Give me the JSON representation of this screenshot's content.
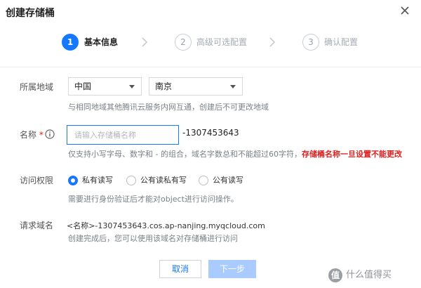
{
  "dialog": {
    "title": "创建存储桶",
    "close_icon": "close-icon"
  },
  "steps": [
    {
      "number": "1",
      "label": "基本信息",
      "state": "active"
    },
    {
      "number": "2",
      "label": "高级可选配置",
      "state": "todo"
    },
    {
      "number": "3",
      "label": "确认配置",
      "state": "todo"
    }
  ],
  "form": {
    "region": {
      "label": "所属地域",
      "country": "中国",
      "city": "南京",
      "hint": "与相同地域其他腾讯云服务内网互通，创建后不可更改地域"
    },
    "name": {
      "label": "名称",
      "required_mark": "*",
      "info_icon": "info-icon",
      "placeholder": "请输入存储桶名称",
      "value": "",
      "suffix": "-1307453643",
      "hint": "仅支持小写字母、数字和 - 的组合，域名字数总和不能超过60字符，",
      "warning": "存储桶名称一旦设置不能更改"
    },
    "access": {
      "label": "访问权限",
      "options": [
        {
          "label": "私有读写",
          "checked": true
        },
        {
          "label": "公有读私有写",
          "checked": false
        },
        {
          "label": "公有读写",
          "checked": false
        }
      ],
      "hint": "需要进行身份验证后才能对object进行访问操作。"
    },
    "domain": {
      "label": "请求域名",
      "value": "<名称>-1307453643.cos.ap-nanjing.myqcloud.com",
      "hint": "创建完成后，您可以使用该域名对存储桶进行访问"
    }
  },
  "footer": {
    "cancel_label": "取消",
    "next_label": "下一步"
  },
  "watermark": {
    "logo_char": "值",
    "text": "什么值得买"
  },
  "colors": {
    "accent": "#1677ff",
    "warning": "#e02020",
    "disabled_button": "#a9cbff"
  }
}
